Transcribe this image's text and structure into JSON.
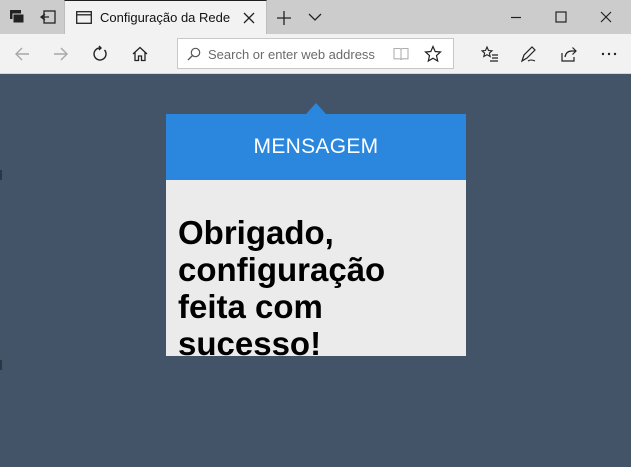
{
  "browser": {
    "tab": {
      "title": "Configuração da Rede"
    },
    "address_bar": {
      "placeholder": "Search or enter web address"
    },
    "icons": {
      "tab_actions": "tab-actions-icon",
      "set_aside_tabs": "set-aside-tabs-icon",
      "page": "page-icon",
      "close_tab": "close-icon",
      "new_tab": "plus-icon",
      "tab_menu": "chevron-down-icon",
      "minimize": "minimize-icon",
      "maximize": "maximize-icon",
      "close_window": "close-window-icon",
      "back": "back-arrow-icon",
      "forward": "forward-arrow-icon",
      "refresh": "refresh-icon",
      "home": "home-icon",
      "search": "search-icon",
      "reading_view": "book-icon",
      "favorite": "star-icon",
      "favorites_list": "favorites-list-icon",
      "notes": "pen-icon",
      "share": "share-icon",
      "more": "more-icon"
    }
  },
  "page": {
    "card": {
      "header": "MENSAGEM",
      "message": "Obrigado, configuração feita com sucesso!"
    }
  },
  "colors": {
    "background": "#445468",
    "card_header": "#2b86dd",
    "card_body": "#ebebeb"
  }
}
